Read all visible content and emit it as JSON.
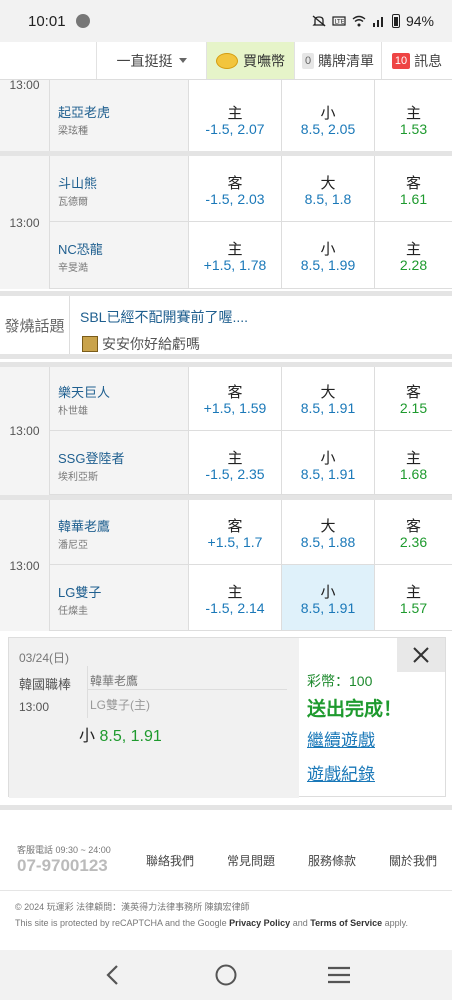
{
  "status_bar": {
    "time": "10:01",
    "battery": "94%"
  },
  "nav": {
    "sort": "一直挺挺",
    "buy": "買嘸幣",
    "cart_count": "0",
    "cart": "購牌清單",
    "msg_count": "10",
    "msg": "訊息"
  },
  "games": [
    {
      "time": "13:00",
      "rows": [
        {
          "team": "起亞老虎",
          "pitcher": "梁玹種",
          "spread_lab": "主",
          "spread": "-1.5, 2.07",
          "total_lab": "小",
          "total": "8.5, 2.05",
          "ml_lab": "主",
          "ml": "1.53"
        }
      ]
    },
    {
      "time": "13:00",
      "rows": [
        {
          "team": "斗山熊",
          "pitcher": "瓦德爾",
          "spread_lab": "客",
          "spread": "-1.5, 2.03",
          "total_lab": "大",
          "total": "8.5, 1.8",
          "ml_lab": "客",
          "ml": "1.61"
        },
        {
          "team": "NC恐龍",
          "pitcher": "辛旻澔",
          "spread_lab": "主",
          "spread": "+1.5, 1.78",
          "total_lab": "小",
          "total": "8.5, 1.99",
          "ml_lab": "主",
          "ml": "2.28"
        }
      ]
    },
    {
      "time": "13:00",
      "rows": [
        {
          "team": "樂天巨人",
          "pitcher": "朴世雄",
          "spread_lab": "客",
          "spread": "+1.5, 1.59",
          "total_lab": "大",
          "total": "8.5, 1.91",
          "ml_lab": "客",
          "ml": "2.15"
        },
        {
          "team": "SSG登陸者",
          "pitcher": "埃利亞斯",
          "spread_lab": "主",
          "spread": "-1.5, 2.35",
          "total_lab": "小",
          "total": "8.5, 1.91",
          "ml_lab": "主",
          "ml": "1.68"
        }
      ]
    },
    {
      "time": "13:00",
      "rows": [
        {
          "team": "韓華老鷹",
          "pitcher": "潘尼亞",
          "spread_lab": "客",
          "spread": "+1.5, 1.7",
          "total_lab": "大",
          "total": "8.5, 1.88",
          "ml_lab": "客",
          "ml": "2.36"
        },
        {
          "team": "LG雙子",
          "pitcher": "任燦圭",
          "spread_lab": "主",
          "spread": "-1.5, 2.14",
          "total_lab": "小",
          "total": "8.5, 1.91",
          "ml_lab": "主",
          "ml": "1.57"
        }
      ]
    }
  ],
  "hot_topic": {
    "label": "發燒話題",
    "title": "SBL已經不配開賽前了喔....",
    "reply": "安安你好給虧嗎"
  },
  "popup": {
    "date": "03/24(日)",
    "league": "韓國職棒",
    "time": "13:00",
    "away": "韓華老鷹",
    "home": "LG雙子(主)",
    "bet_lab": "小",
    "bet_odds": "8.5, 1.91",
    "coins": "彩幣：100",
    "done": "送出完成！",
    "continue": "繼續遊戲",
    "history": "遊戲紀錄"
  },
  "footer": {
    "hotline_label": "客服電話 09:30 ~ 24:00",
    "phone": "07-9700123",
    "links": [
      "聯絡我們",
      "常見問題",
      "服務條款",
      "關於我們"
    ],
    "copyright": "© 2024 玩運彩 法律顧問：漢英得力法律事務所 陳鎮宏律師",
    "recaptcha_pre": "This site is protected by reCAPTCHA and the Google",
    "privacy": "Privacy Policy",
    "and": "and",
    "terms": "Terms of Service",
    "apply": "apply."
  },
  "colors": {
    "accent_blue": "#1a78b8",
    "accent_green": "#1e9a2e",
    "selected_bg": "#dff1fa",
    "badge_red": "#ee4444"
  }
}
